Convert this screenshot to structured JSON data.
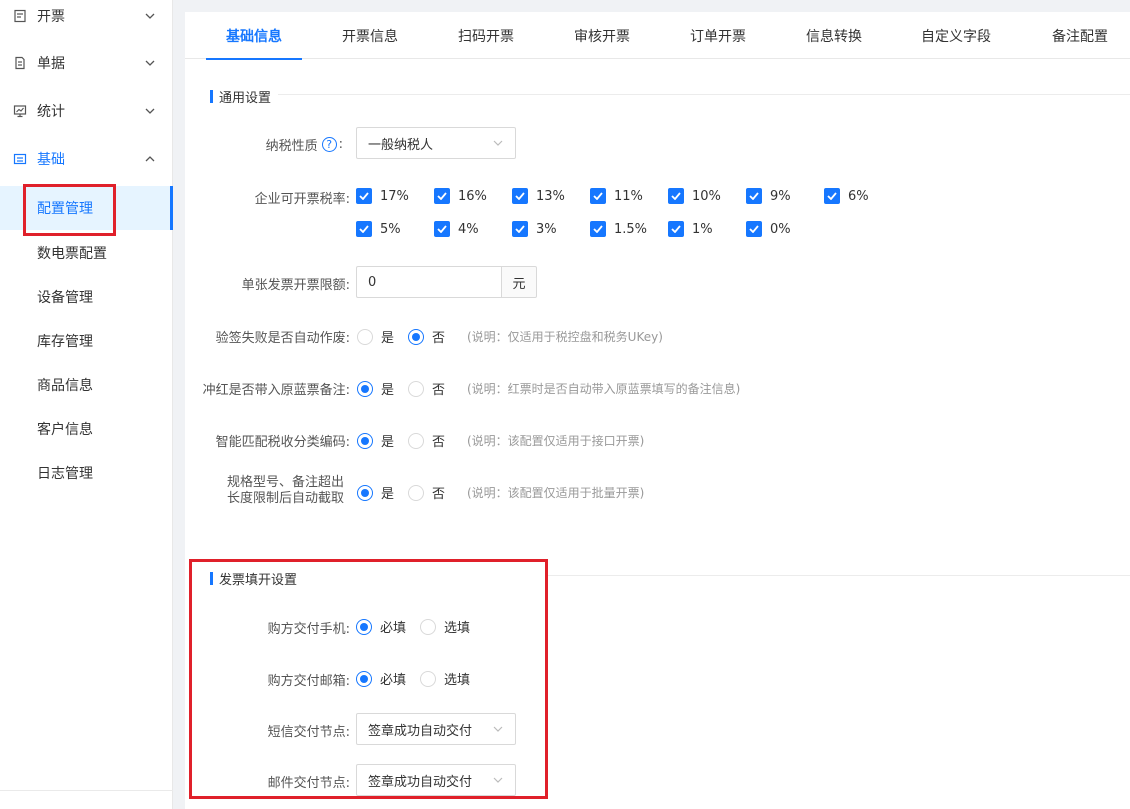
{
  "sidebar": {
    "groups": [
      {
        "label": "开票",
        "icon": "invoice-icon",
        "expanded": false
      },
      {
        "label": "单据",
        "icon": "document-icon",
        "expanded": false
      },
      {
        "label": "统计",
        "icon": "chart-icon",
        "expanded": false
      },
      {
        "label": "基础",
        "icon": "settings-card-icon",
        "expanded": true
      }
    ],
    "sub_items": [
      "配置管理",
      "数电票配置",
      "设备管理",
      "库存管理",
      "商品信息",
      "客户信息",
      "日志管理"
    ],
    "active_sub": "配置管理"
  },
  "tabs": [
    "基础信息",
    "开票信息",
    "扫码开票",
    "审核开票",
    "订单开票",
    "信息转换",
    "自定义字段",
    "备注配置"
  ],
  "active_tab": "基础信息",
  "general": {
    "title": "通用设置",
    "taxpayer_label": "纳税性质",
    "taxpayer_value": "一般纳税人",
    "tax_rates_label": "企业可开票税率:",
    "tax_rates": [
      "17%",
      "16%",
      "13%",
      "11%",
      "10%",
      "9%",
      "6%",
      "5%",
      "4%",
      "3%",
      "1.5%",
      "1%",
      "0%"
    ],
    "limit_label": "单张发票开票限额:",
    "limit_value": "0",
    "limit_unit": "元",
    "rows": [
      {
        "label": "验签失败是否自动作废:",
        "opt1": "是",
        "opt2": "否",
        "selected": 2,
        "note": "(说明：仅适用于税控盘和税务UKey)"
      },
      {
        "label": "冲红是否带入原蓝票备注:",
        "opt1": "是",
        "opt2": "否",
        "selected": 1,
        "note": "(说明：红票时是否自动带入原蓝票填写的备注信息)"
      },
      {
        "label": "智能匹配税收分类编码:",
        "opt1": "是",
        "opt2": "否",
        "selected": 1,
        "note": "(说明：该配置仅适用于接口开票)"
      },
      {
        "label": "规格型号、备注超出长度限制后自动截取",
        "opt1": "是",
        "opt2": "否",
        "selected": 1,
        "note": "(说明：该配置仅适用于批量开票)"
      }
    ]
  },
  "invoice_fill": {
    "title": "发票填开设置",
    "buyer_phone_label": "购方交付手机:",
    "buyer_email_label": "购方交付邮箱:",
    "required_label": "必填",
    "optional_label": "选填",
    "sms_node_label": "短信交付节点:",
    "sms_node_value": "签章成功自动交付",
    "mail_node_label": "邮件交付节点:",
    "mail_node_value": "签章成功自动交付"
  },
  "colors": {
    "accent": "#1677ff",
    "highlight": "#e0202a"
  }
}
